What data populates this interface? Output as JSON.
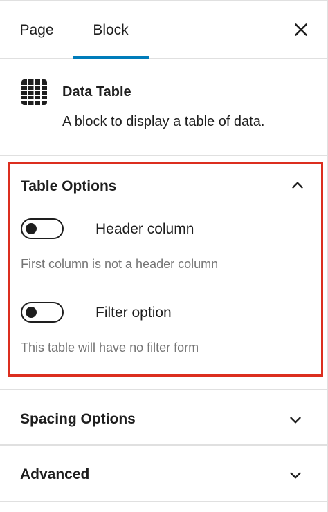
{
  "tabs": {
    "page_label": "Page",
    "block_label": "Block",
    "close_icon": "close-icon"
  },
  "block_card": {
    "icon": "table-icon",
    "title": "Data Table",
    "description": "A block to display a table of data."
  },
  "table_options": {
    "title": "Table Options",
    "header_column": {
      "label": "Header column",
      "enabled": false,
      "help": "First column is not a header column"
    },
    "filter_option": {
      "label": "Filter option",
      "enabled": false,
      "help": "This table will have no filter form"
    },
    "expanded": true,
    "highlight_color": "#dc2e1f"
  },
  "sections": {
    "spacing": {
      "title": "Spacing Options",
      "expanded": false
    },
    "advanced": {
      "title": "Advanced",
      "expanded": false
    }
  },
  "colors": {
    "accent": "#007cba",
    "text": "#1e1e1e",
    "muted": "#757575",
    "border": "#e0e0e0"
  }
}
